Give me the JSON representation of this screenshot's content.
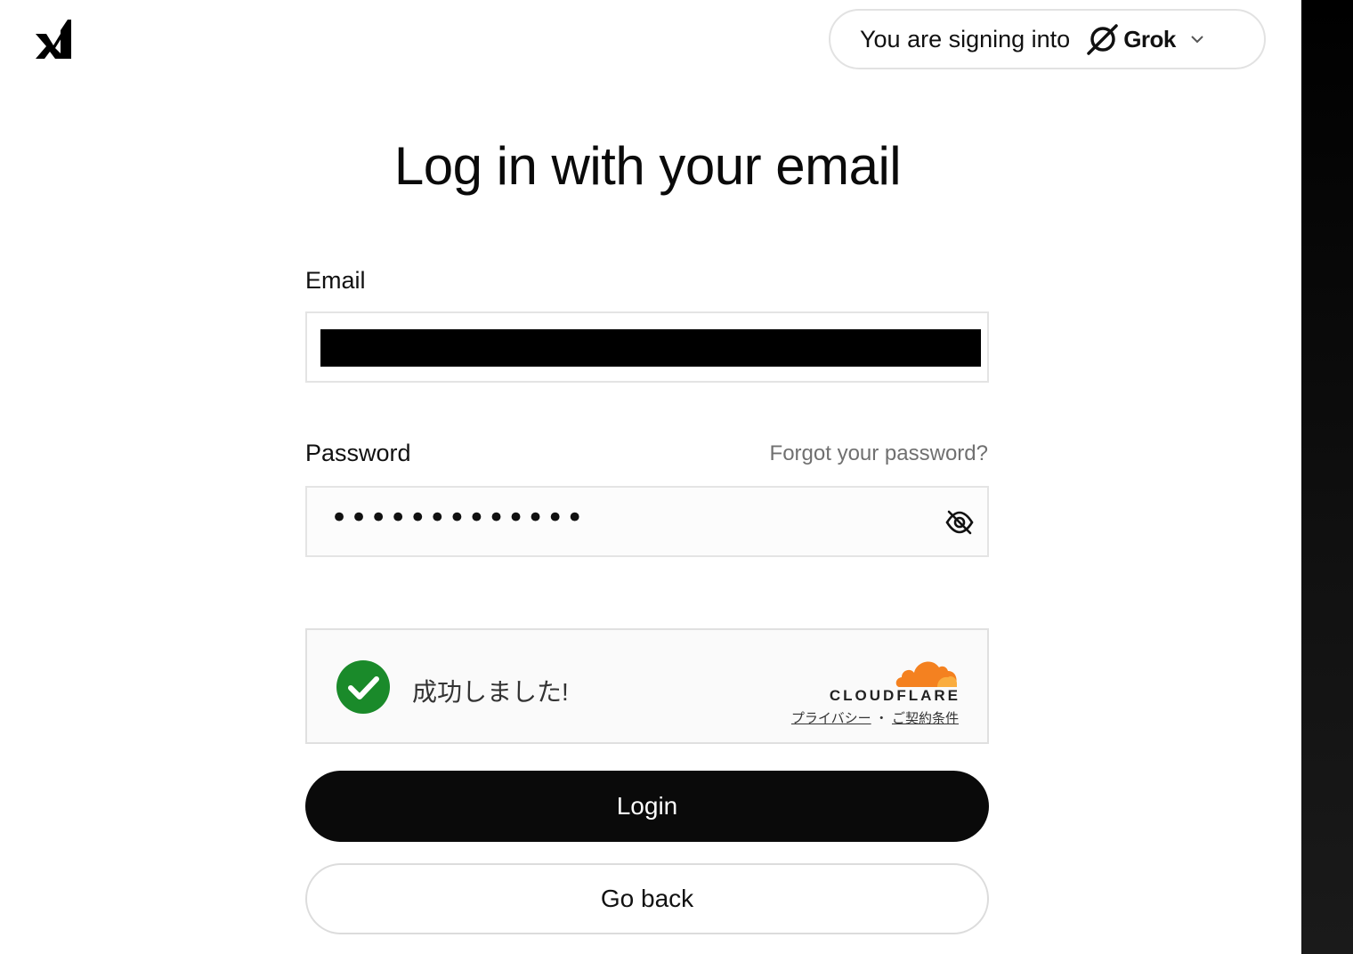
{
  "header": {
    "logo_icon": "xai-logo-icon",
    "signing_into_text": "You are signing into",
    "product_icon": "grok-logo-icon",
    "product_name": "Grok",
    "dropdown_icon": "chevron-down-icon"
  },
  "main": {
    "title": "Log in with your email",
    "email": {
      "label": "Email",
      "value_redacted": true
    },
    "password": {
      "label": "Password",
      "forgot_link": "Forgot your password?",
      "masked_value": "•••••••••••••",
      "toggle_icon": "eye-off-icon"
    },
    "captcha": {
      "status_icon": "check-circle-icon",
      "status_text": "成功しました!",
      "brand_icon": "cloudflare-cloud-icon",
      "brand_name": "CLOUDFLARE",
      "privacy_link": "プライバシー",
      "separator": "・",
      "terms_link": "ご契約条件"
    },
    "login_button": "Login",
    "back_button": "Go back"
  },
  "colors": {
    "primary_button": "#0a0a0a",
    "success_green": "#1a8a2a",
    "cloudflare_orange": "#f48120",
    "muted_text": "#707070"
  }
}
